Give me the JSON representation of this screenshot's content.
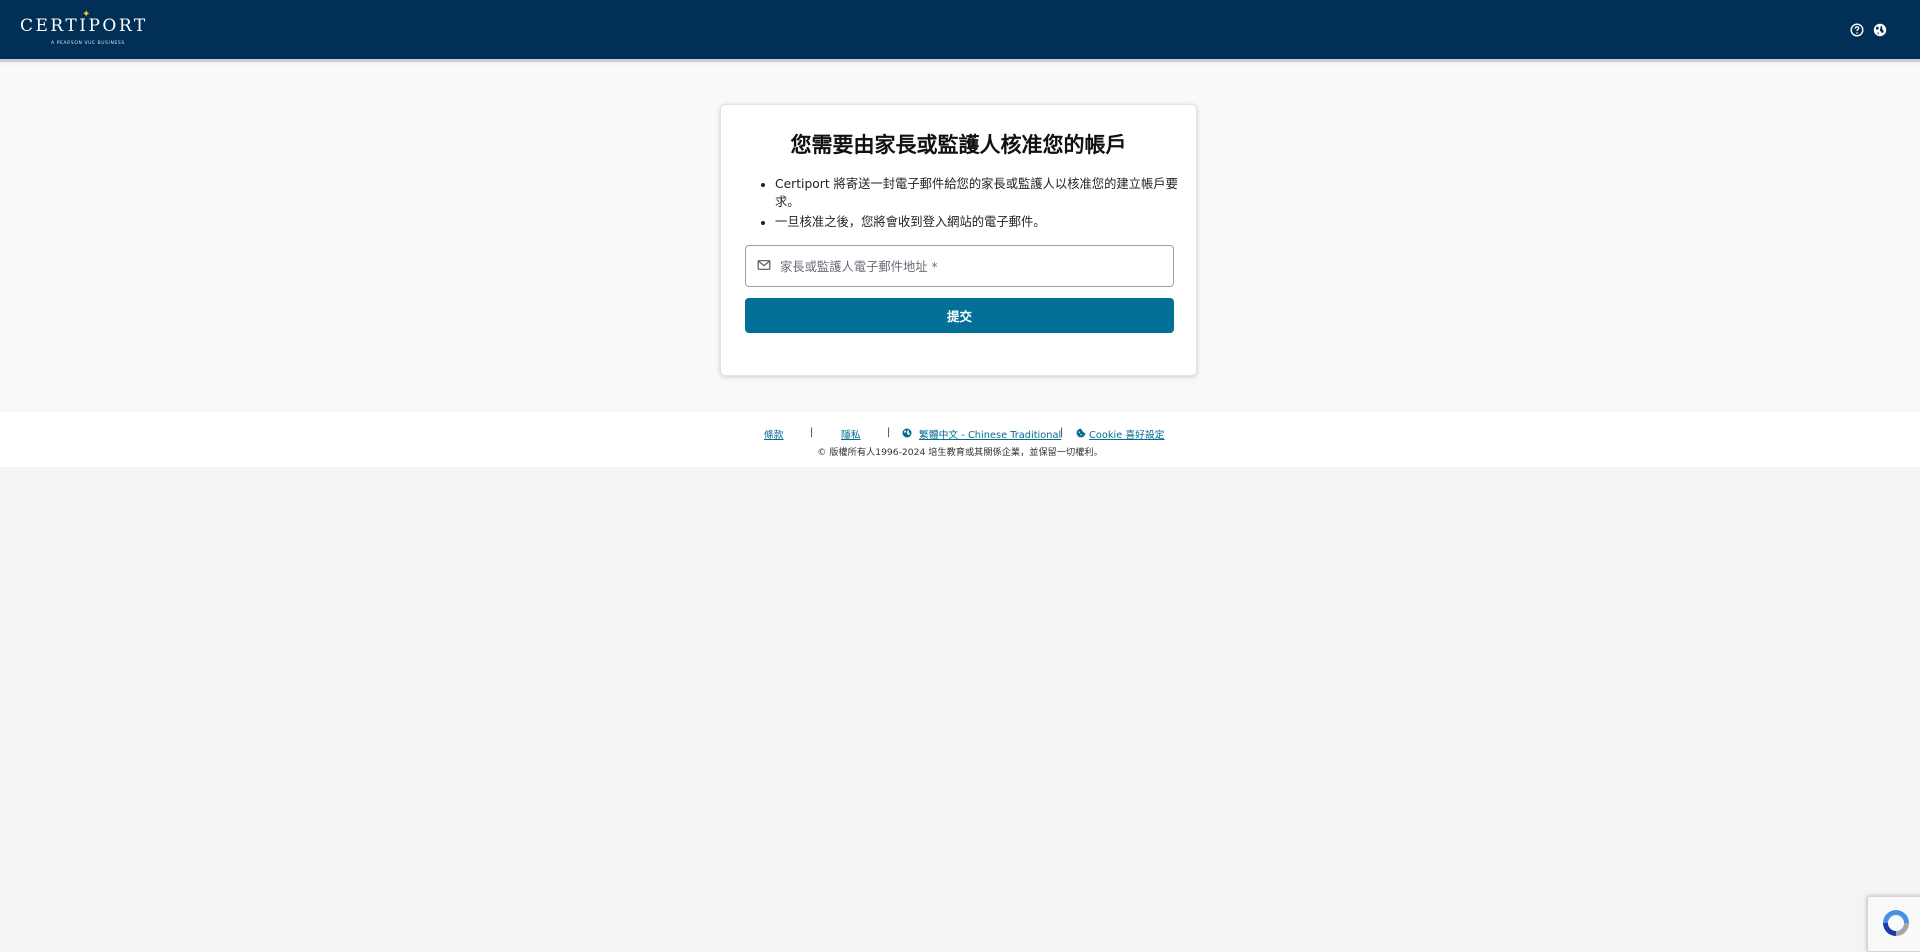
{
  "header": {
    "logo_text": "CERTIPORT",
    "logo_subtext": "A PEARSON VUE BUSINESS",
    "icons": [
      "help-icon",
      "globe-icon"
    ]
  },
  "card": {
    "title": "您需要由家長或監護人核准您的帳戶",
    "bullets": [
      "Certiport 將寄送一封電子郵件給您的家長或監護人以核准您的建立帳戶要求。",
      "一旦核准之後，您將會收到登入網站的電子郵件。"
    ],
    "email_placeholder": "家長或監護人電子郵件地址 *",
    "submit_label": "提交"
  },
  "footer": {
    "terms": "條款",
    "privacy": "隱私",
    "separator": "|",
    "language": "繁體中文 - Chinese Traditional",
    "cookie": "Cookie 喜好設定",
    "copyright": "© 版權所有人1996-2024 培生教育或其關係企業，並保留一切權利。"
  },
  "colors": {
    "header_bg": "#012f56",
    "primary_button": "#037097",
    "link": "#036c92",
    "page_bg": "#f3f4f6"
  }
}
